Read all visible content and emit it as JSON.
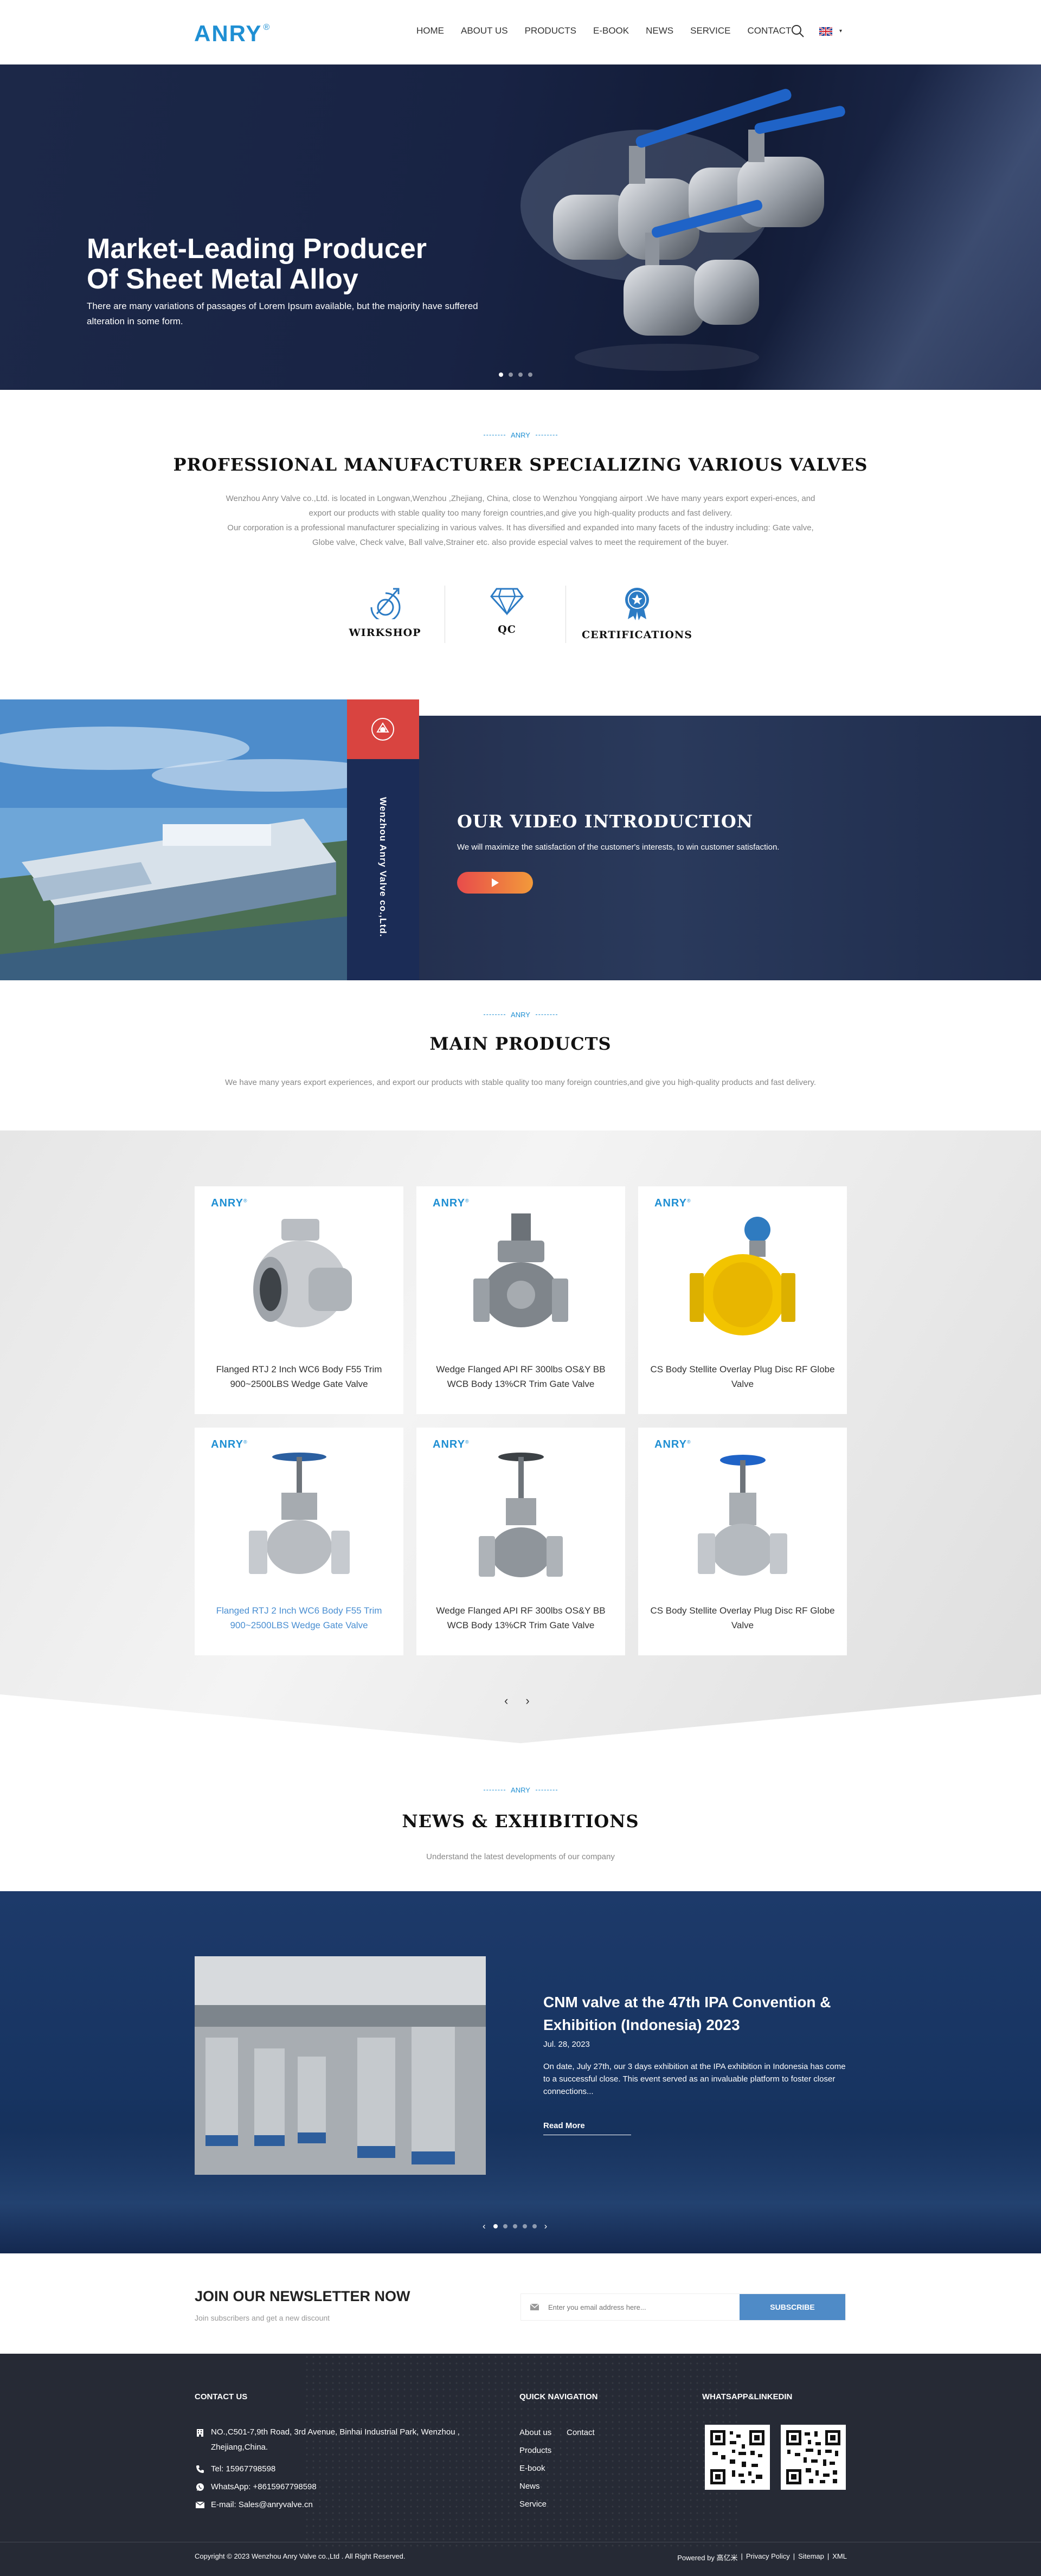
{
  "header": {
    "logo": "ANRY",
    "logo_mark": "®",
    "nav": [
      "HOME",
      "ABOUT US",
      "PRODUCTS",
      "E-BOOK",
      "NEWS",
      "SERVICE",
      "CONTACT"
    ],
    "language_caret": "▾"
  },
  "hero": {
    "title_line1": "Market-Leading Producer",
    "title_line2": "Of Sheet Metal Alloy",
    "subtitle": "There are many variations of passages of Lorem Ipsum available, but the majority have suffered alteration in some form.",
    "slide_active": 1,
    "slide_count": 4
  },
  "about": {
    "tag": "ANRY",
    "title": "PROFESSIONAL MANUFACTURER SPECIALIZING VARIOUS VALVES",
    "paragraph1": "Wenzhou Anry Valve co.,Ltd. is located in Longwan,Wenzhou ,Zhejiang, China, close to Wenzhou Yongqiang airport .We have many years export experi-ences, and export our products with stable quality too many foreign countries,and give you high-quality products and fast delivery.",
    "paragraph2": "Our corporation is a professional manufacturer specializing in various valves. It has diversified and expanded into many facets of the industry including: Gate valve, Globe valve, Check valve, Ball valve,Strainer etc. also provide especial valves to meet the requirement of the buyer.",
    "features": [
      "WIRKSHOP",
      "QC",
      "CERTIFICATIONS"
    ]
  },
  "video": {
    "company_vertical": "Wenzhou Anry Valve co.,Ltd.",
    "title": "OUR VIDEO INTRODUCTION",
    "subtitle": "We will maximize the satisfaction of the customer's interests, to win customer satisfaction."
  },
  "products": {
    "tag": "ANRY",
    "title": "MAIN PRODUCTS",
    "description": "We have many years export experiences, and export our products with stable quality too many foreign countries,and give you high-quality products and fast delivery.",
    "brand": "ANRY",
    "items": [
      {
        "name": "Flanged RTJ 2 Inch WC6 Body F55 Trim 900~2500LBS Wedge Gate Valve"
      },
      {
        "name": "Wedge Flanged API RF 300lbs OS&Y BB WCB Body 13%CR Trim Gate Valve"
      },
      {
        "name": "CS Body Stellite Overlay Plug Disc RF Globe Valve"
      },
      {
        "name": "Flanged RTJ 2 Inch WC6 Body F55 Trim 900~2500LBS Wedge Gate Valve"
      },
      {
        "name": "Wedge Flanged API RF 300lbs OS&Y BB WCB Body 13%CR Trim Gate Valve"
      },
      {
        "name": "CS Body Stellite Overlay Plug Disc RF Globe Valve"
      }
    ],
    "prev": "‹",
    "next": "›"
  },
  "news": {
    "tag": "ANRY",
    "title": "NEWS & EXHIBITIONS",
    "subtitle": "Understand the latest developments of our company",
    "article_title": "CNM valve at the 47th IPA Convention & Exhibition (Indonesia) 2023",
    "article_date": "Jul. 28, 2023",
    "article_body": "On date, July 27th, our 3 days exhibition at the IPA exhibition in Indonesia has come to a successful close. This event served as an invaluable platform to foster closer connections...",
    "read_more": "Read More",
    "prev": "‹",
    "next": "›"
  },
  "newsletter": {
    "title": "JOIN OUR NEWSLETTER NOW",
    "subtitle": "Join subscribers and get a new discount",
    "placeholder": "Enter you email address here...",
    "button": "SUBSCRIBE"
  },
  "footer": {
    "contact_heading": "CONTACT US",
    "address": "NO.,C501-7,9th Road, 3rd Avenue, Binhai Industrial Park, Wenzhou , Zhejiang,China.",
    "tel": "Tel: 15967798598",
    "whatsapp": "WhatsApp: +8615967798598",
    "email": "E-mail: Sales@anryvalve.cn",
    "nav_heading": "QUICK NAVIGATION",
    "nav_links": [
      "About us",
      "Contact",
      "Products",
      "E-book",
      "News",
      "Service"
    ],
    "social_heading": "WHATSAPP&LINKEDIN",
    "copyright": "Copyright © 2023 Wenzhou Anry Valve co.,Ltd . All Right Reserved.",
    "powered": "Powered by 高亿米",
    "privacy": "Privacy Policy",
    "sitemap": "Sitemap",
    "xml": "XML",
    "separator": "|"
  },
  "colors": {
    "brand_blue": "#1f8fd3",
    "hero_navy": "#1c2848",
    "video_red": "#d94440",
    "subscribe_blue": "#4f8bc7",
    "footer_dark": "#262a35"
  }
}
